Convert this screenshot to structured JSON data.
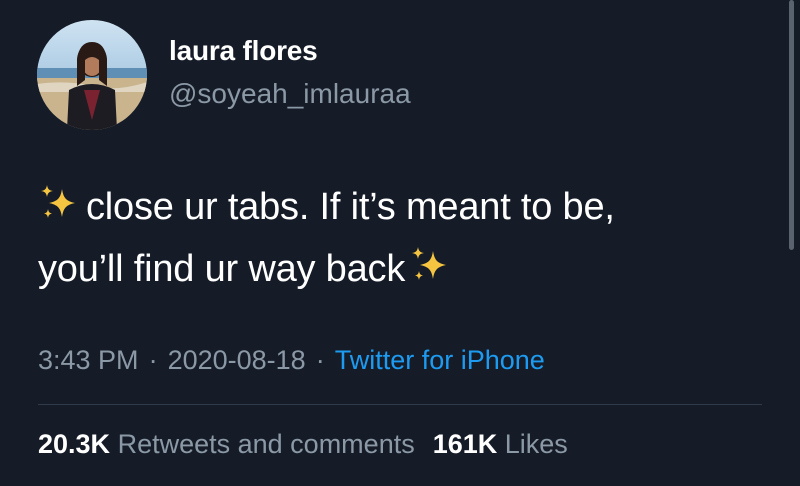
{
  "user": {
    "display_name": "laura flores",
    "handle": "@soyeah_imlauraa"
  },
  "tweet": {
    "line1": "close ur tabs. If it’s meant to be,",
    "line2": "you’ll find ur way back"
  },
  "meta": {
    "time": "3:43 PM",
    "separator": "·",
    "date": "2020-08-18",
    "source": "Twitter for iPhone"
  },
  "stats": {
    "retweets_count": "20.3K",
    "retweets_label": "Retweets and comments",
    "likes_count": "161K",
    "likes_label": "Likes"
  },
  "colors": {
    "background": "#151c28",
    "text": "#ffffff",
    "muted": "#8b98a5",
    "link": "#1d9bf0",
    "sparkle": "#f5c542"
  },
  "icons": {
    "sparkle": "sparkles-icon",
    "avatar": "avatar"
  }
}
